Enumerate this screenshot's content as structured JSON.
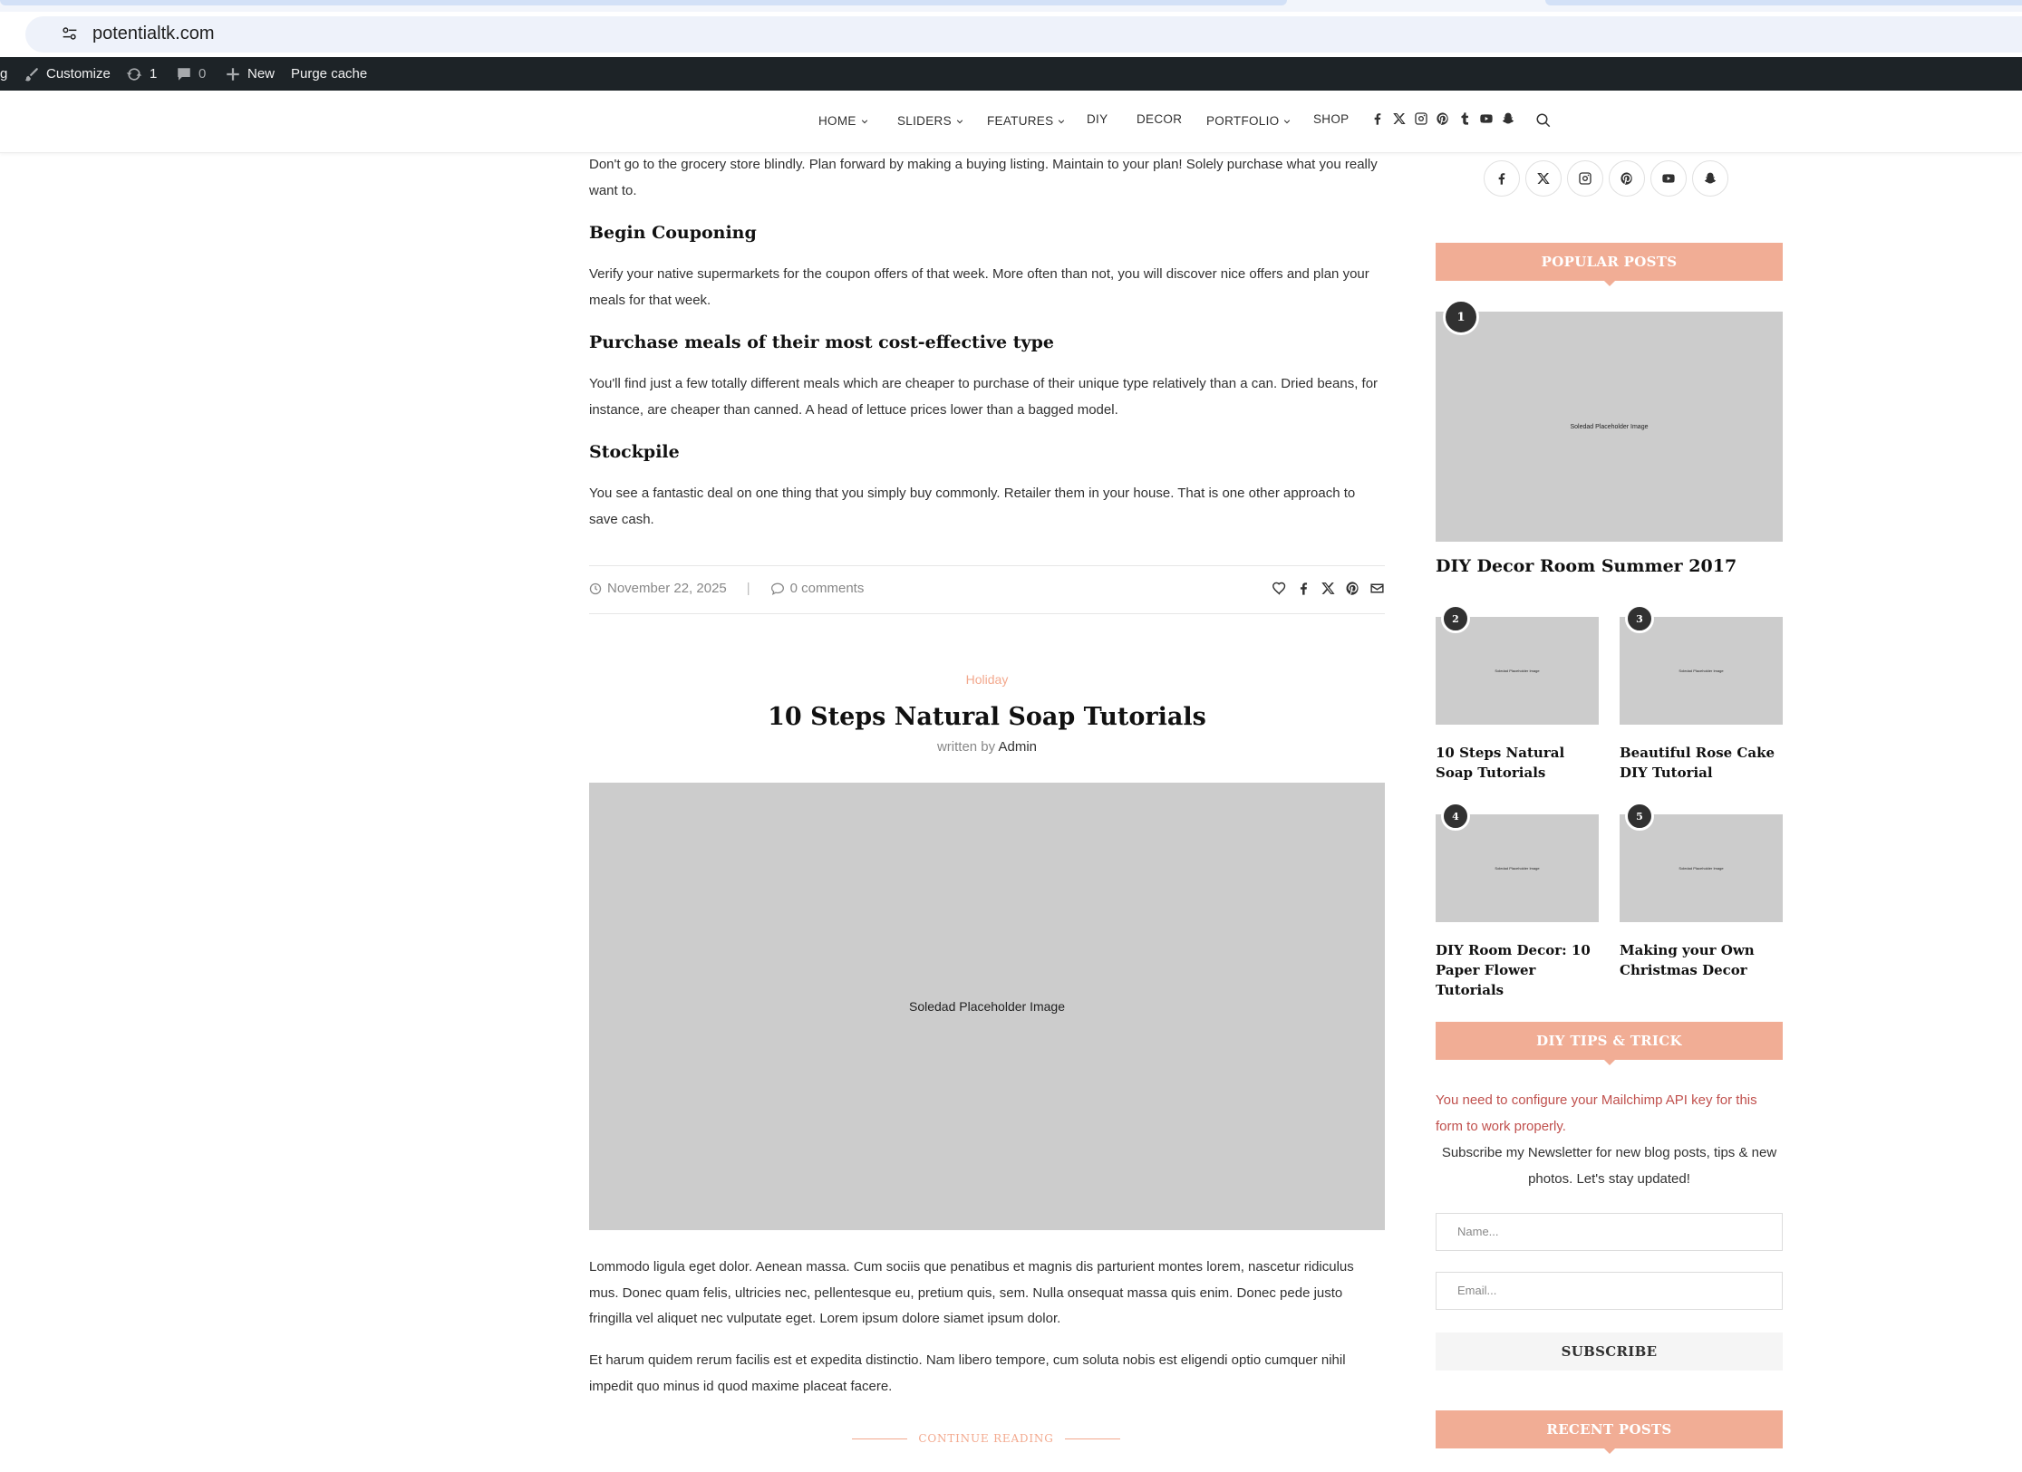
{
  "browser": {
    "url": "potentialtk.com"
  },
  "adminbar": {
    "items": [
      {
        "label": "g",
        "icon": "wordpress-icon"
      },
      {
        "label": "Customize",
        "icon": "brush-icon"
      },
      {
        "label": "1",
        "icon": "updates-icon"
      },
      {
        "label": "0",
        "icon": "comment-icon"
      },
      {
        "label": "New",
        "icon": "plus-icon"
      },
      {
        "label": "Purge cache"
      }
    ]
  },
  "nav": {
    "items": [
      {
        "label": "HOME",
        "dropdown": true
      },
      {
        "label": "SLIDERS",
        "dropdown": true
      },
      {
        "label": "FEATURES",
        "dropdown": true
      },
      {
        "label": "DIY",
        "dropdown": false
      },
      {
        "label": "DECOR",
        "dropdown": false
      },
      {
        "label": "PORTFOLIO",
        "dropdown": true
      },
      {
        "label": "SHOP",
        "dropdown": false
      }
    ],
    "social_icons": [
      "facebook-icon",
      "x-icon",
      "instagram-icon",
      "pinterest-icon",
      "tumblr-icon",
      "youtube-icon",
      "snapchat-icon"
    ],
    "search_icon": "search-icon"
  },
  "article_prev": {
    "intro": "Don't go to the grocery store blindly. Plan forward by making a buying listing. Maintain to your plan! Solely purchase what you really want to.",
    "sections": [
      {
        "heading": "Begin Couponing",
        "text": "Verify your native supermarkets for the coupon offers of that week. More often than not, you will discover nice offers and plan your meals for that week."
      },
      {
        "heading": "Purchase meals of their most cost-effective type",
        "text": "You'll find just a few totally different meals which are cheaper to purchase of their unique type relatively than a can. Dried beans, for instance, are cheaper than canned. A head of lettuce prices lower than a bagged model."
      },
      {
        "heading": "Stockpile",
        "text": "You see a fantastic deal on one thing that you simply buy commonly. Retailer them in your house. That is one other approach to save cash."
      }
    ],
    "date": "November 22, 2025",
    "separator": "|",
    "comments": "0 comments",
    "share_icons": [
      "heart-icon",
      "facebook-icon",
      "x-icon",
      "pinterest-icon",
      "email-icon"
    ]
  },
  "article_next": {
    "category": "Holiday",
    "title": "10 Steps Natural Soap Tutorials",
    "byline_prefix": "written by",
    "author": "Admin",
    "image_label": "Soledad Placeholder Image",
    "paragraphs": [
      "Lommodo ligula eget dolor. Aenean massa. Cum sociis que penatibus et magnis dis parturient montes lorem, nascetur ridiculus mus. Donec quam felis, ultricies nec, pellentesque eu, pretium quis, sem. Nulla onsequat massa quis enim. Donec pede justo fringilla vel aliquet nec vulputate eget. Lorem ipsum dolore siamet ipsum dolor.",
      "Et harum quidem rerum facilis est et expedita distinctio. Nam libero tempore, cum soluta nobis est eligendi optio cumquer nihil impedit quo minus id quod maxime placeat facere."
    ],
    "continue_label": "CONTINUE READING"
  },
  "sidebar": {
    "social_icons": [
      "facebook-icon",
      "x-icon",
      "instagram-icon",
      "pinterest-icon",
      "youtube-icon",
      "snapchat-icon"
    ],
    "popular_posts": {
      "title": "POPULAR POSTS",
      "image_label": "Soledad Placeholder Image",
      "posts": [
        {
          "rank": "1",
          "title": "DIY Decor Room Summer 2017"
        },
        {
          "rank": "2",
          "title": "10 Steps Natural Soap Tutorials"
        },
        {
          "rank": "3",
          "title": "Beautiful Rose Cake DIY Tutorial"
        },
        {
          "rank": "4",
          "title": "DIY Room Decor: 10 Paper Flower Tutorials"
        },
        {
          "rank": "5",
          "title": "Making your Own Christmas Decor"
        }
      ]
    },
    "newsletter": {
      "title": "DIY TIPS & TRICK",
      "warning": "You need to configure your Mailchimp API key for this form to work properly.",
      "description": "Subscribe my Newsletter for new blog posts, tips & new photos. Let's stay updated!",
      "name_placeholder": "Name...",
      "email_placeholder": "Email...",
      "button": "SUBSCRIBE"
    },
    "recent_posts": {
      "title": "RECENT POSTS"
    }
  }
}
